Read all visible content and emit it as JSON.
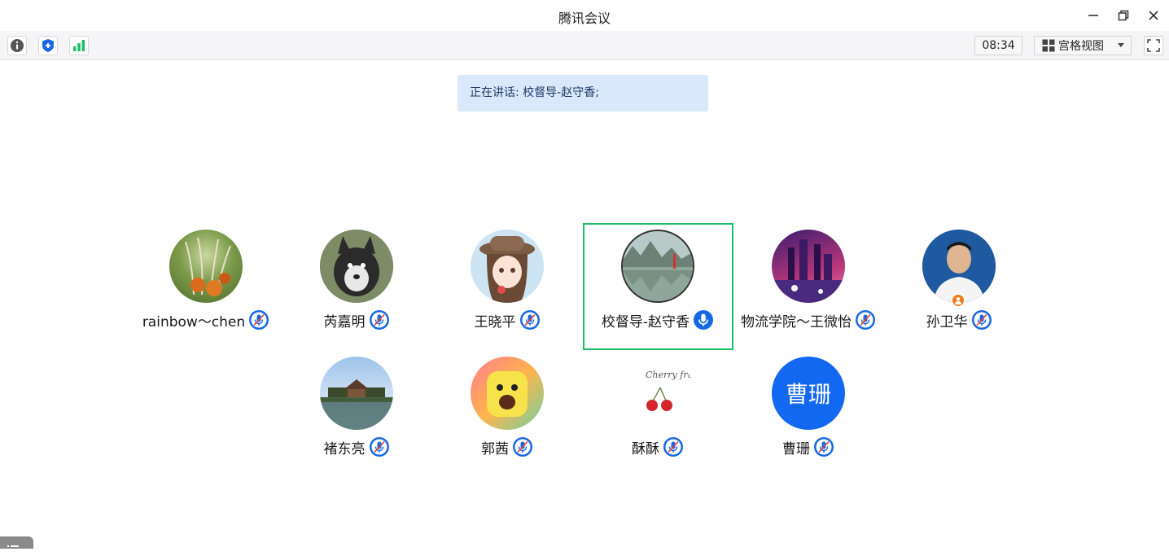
{
  "window": {
    "title": "腾讯会议",
    "controls": [
      "minimize-icon",
      "restore-icon",
      "close-icon"
    ]
  },
  "toolbar": {
    "left_icons": [
      "info-icon",
      "shield-icon",
      "signal-icon"
    ],
    "timer": "08:34",
    "view_label": "宫格视图",
    "fullscreen_icon": "fullscreen-icon"
  },
  "speaking": {
    "text": "正在讲话: 校督导-赵守香;"
  },
  "colors": {
    "accent": "#1668e3",
    "active_border": "#1fbe6b",
    "banner_bg": "#d9e8fb"
  },
  "participants": [
    {
      "name": "rainbow～chen",
      "mic": "muted",
      "avatar": "pampas-grass-photo"
    },
    {
      "name": "芮嘉明",
      "mic": "muted",
      "avatar": "dog-photo"
    },
    {
      "name": "王晓平",
      "mic": "muted",
      "avatar": "anime-girl"
    },
    {
      "name": "校督导-赵守香",
      "mic": "active",
      "avatar": "lake-landscape-photo"
    },
    {
      "name": "物流学院～王微怡",
      "mic": "muted",
      "avatar": "fantasy-city-art"
    },
    {
      "name": "孙卫华",
      "mic": "muted",
      "avatar": "man-portrait-photo"
    },
    {
      "name": "褚东亮",
      "mic": "muted",
      "avatar": "pavilion-photo"
    },
    {
      "name": "郭茜",
      "mic": "muted",
      "avatar": "cartoon-character"
    },
    {
      "name": "酥酥",
      "mic": "muted",
      "avatar": "cherry-drawing"
    },
    {
      "name": "曹珊",
      "mic": "muted",
      "avatar": "initials",
      "initials": "曹珊"
    }
  ],
  "cherry_text": "Cherry fruits"
}
